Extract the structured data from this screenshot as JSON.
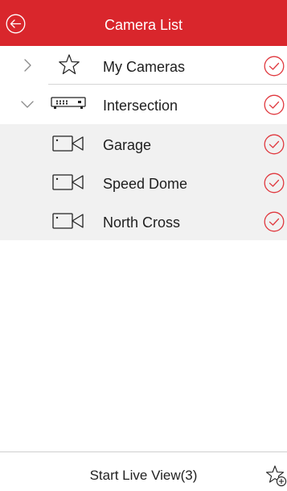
{
  "header": {
    "title": "Camera List",
    "back_icon": "circle-back-arrow-icon",
    "background_color": "#d9262c",
    "text_color": "#ffffff"
  },
  "tree": {
    "my_cameras": {
      "label": "My Cameras",
      "expanded": false,
      "icon": "star-outline-icon",
      "selected": true
    },
    "intersection": {
      "label": "Intersection",
      "expanded": true,
      "icon": "nvr-recorder-icon",
      "selected": true,
      "cameras": [
        {
          "label": "Garage",
          "icon": "camera-icon",
          "selected": true
        },
        {
          "label": "Speed Dome",
          "icon": "camera-icon",
          "selected": true
        },
        {
          "label": "North Cross",
          "icon": "camera-icon",
          "selected": true
        }
      ]
    },
    "check_color": "#e0393f"
  },
  "footer": {
    "start_live_label": "Start Live View(3)",
    "add_favorite_icon": "star-plus-icon"
  }
}
